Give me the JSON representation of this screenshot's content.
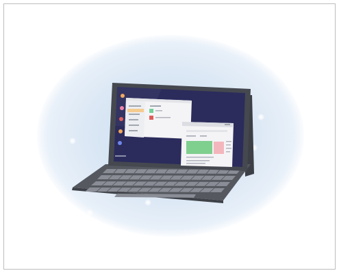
{
  "illustration": {
    "subject": "tablet-with-keyboard-cover",
    "colors": {
      "background": "#ffffff",
      "glow": "#d6e4f3",
      "tablet_bezel": "#4a4d55",
      "screen_bg": "#2b2c5c",
      "keyboard": "#5b5e66",
      "window_bg": "#f4f4f6",
      "accent_orange": "#f0a55a",
      "accent_red": "#e05a5a",
      "accent_green": "#6fcf97",
      "accent_pink": "#f4b6bd"
    }
  },
  "screen": {
    "dock_icons": [
      "orange-dot-icon",
      "pink-dot-icon",
      "red-dot-icon",
      "orange-dot-icon",
      "blue-dot-icon"
    ],
    "left_window": {
      "list_items": 5,
      "selected_index": 1
    },
    "right_window": {
      "panels": [
        "green-panel",
        "pink-panel"
      ]
    }
  }
}
